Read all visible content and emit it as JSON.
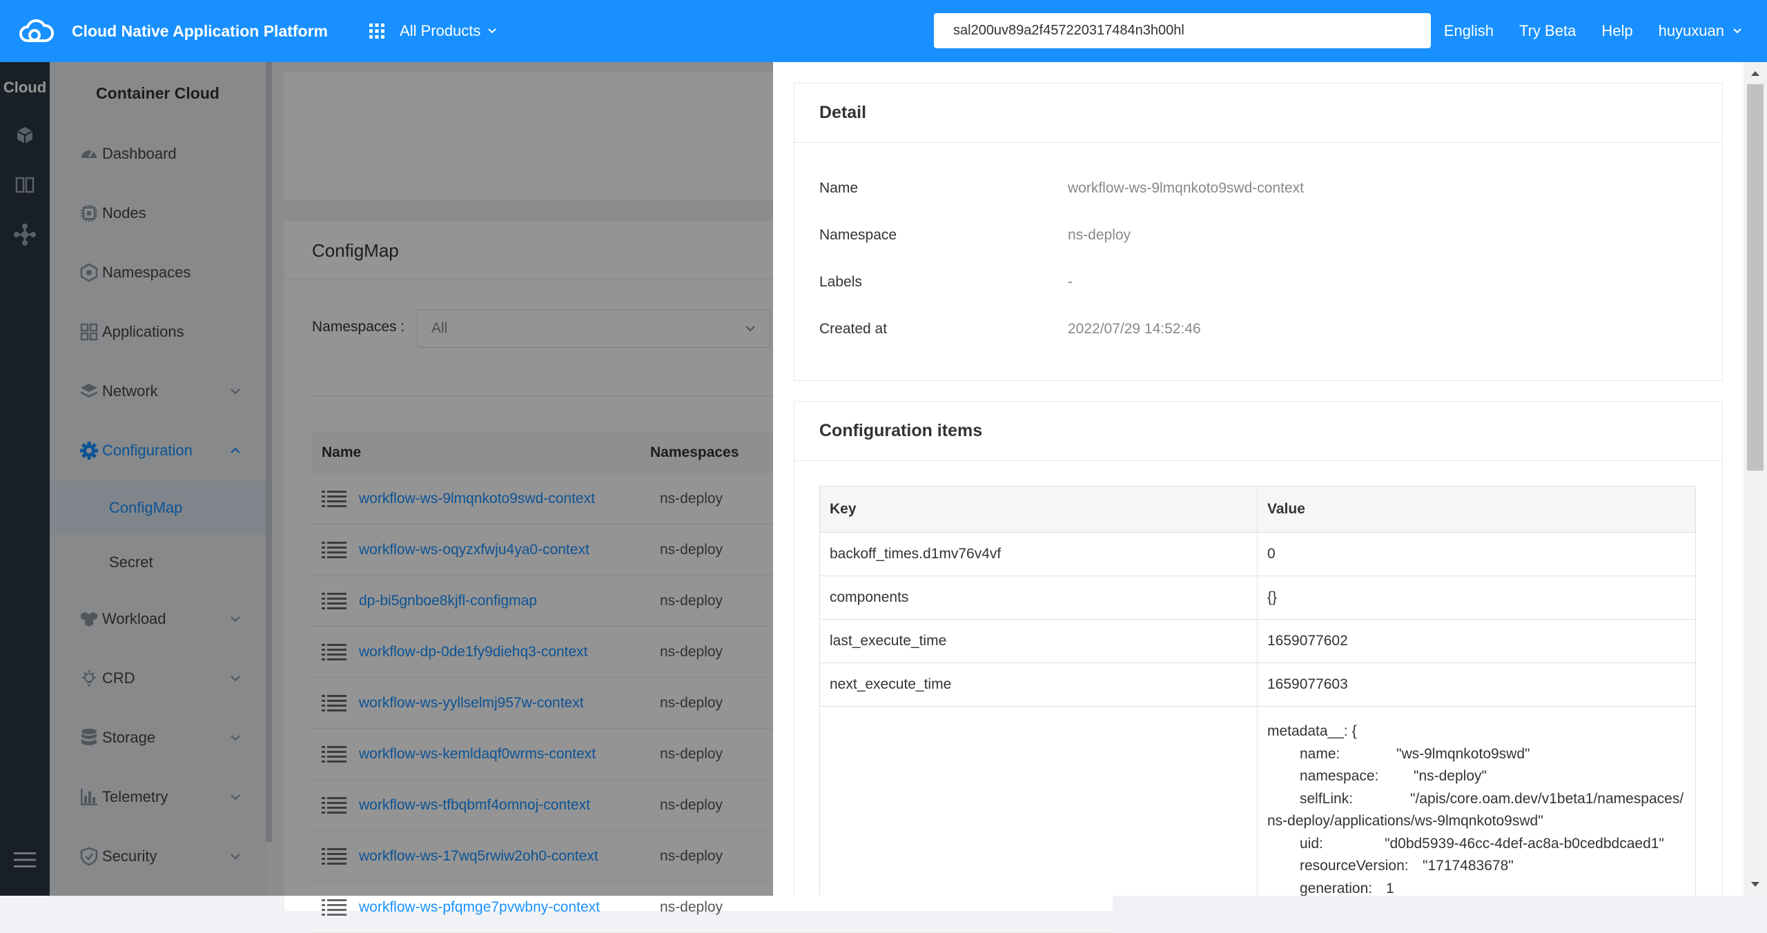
{
  "topbar": {
    "brand": "Cloud Native Application Platform",
    "products_label": "All Products",
    "search_value": "sal200uv89a2f457220317484n3h00hl",
    "nav": [
      "English",
      "Try Beta",
      "Help"
    ],
    "user": "huyuxuan"
  },
  "rail": {
    "title": "Cloud"
  },
  "sidebar": {
    "title": "Container Cloud",
    "items": [
      {
        "label": "Dashboard",
        "icon": "dashboard-icon"
      },
      {
        "label": "Nodes",
        "icon": "chip-icon"
      },
      {
        "label": "Namespaces",
        "icon": "hexagon-icon"
      },
      {
        "label": "Applications",
        "icon": "apps-grid-icon"
      },
      {
        "label": "Network",
        "icon": "layers-icon"
      },
      {
        "label": "Configuration",
        "icon": "gear-icon"
      },
      {
        "label": "Workload",
        "icon": "cubes-icon"
      },
      {
        "label": "CRD",
        "icon": "bulb-icon"
      },
      {
        "label": "Storage",
        "icon": "database-icon"
      },
      {
        "label": "Telemetry",
        "icon": "bar-chart-icon"
      },
      {
        "label": "Security",
        "icon": "shield-icon"
      }
    ],
    "sub_items": [
      "ConfigMap",
      "Secret"
    ]
  },
  "main": {
    "card_title": "ConfigMap",
    "ns_label": "Namespaces :",
    "ns_value": "All",
    "columns": [
      "Name",
      "Namespaces"
    ],
    "rows": [
      {
        "name": "workflow-ws-9lmqnkoto9swd-context",
        "ns": "ns-deploy"
      },
      {
        "name": "workflow-ws-oqyzxfwju4ya0-context",
        "ns": "ns-deploy"
      },
      {
        "name": "dp-bi5gnboe8kjfl-configmap",
        "ns": "ns-deploy"
      },
      {
        "name": "workflow-dp-0de1fy9diehq3-context",
        "ns": "ns-deploy"
      },
      {
        "name": "workflow-ws-yyllselmj957w-context",
        "ns": "ns-deploy"
      },
      {
        "name": "workflow-ws-kemldaqf0wrms-context",
        "ns": "ns-deploy"
      },
      {
        "name": "workflow-ws-tfbqbmf4omnoj-context",
        "ns": "ns-deploy"
      },
      {
        "name": "workflow-ws-17wq5rwiw2oh0-context",
        "ns": "ns-deploy"
      },
      {
        "name": "workflow-ws-pfqmge7pvwbny-context",
        "ns": "ns-deploy"
      }
    ]
  },
  "detail": {
    "title": "Detail",
    "fields": [
      {
        "key": "Name",
        "value": "workflow-ws-9lmqnkoto9swd-context"
      },
      {
        "key": "Namespace",
        "value": "ns-deploy"
      },
      {
        "key": "Labels",
        "value": "-"
      },
      {
        "key": "Created at",
        "value": "2022/07/29 14:52:46"
      }
    ]
  },
  "config": {
    "title": "Configuration items",
    "columns": [
      "Key",
      "Value"
    ],
    "rows": [
      {
        "key": "backoff_times.d1mv76v4vf",
        "value": "0"
      },
      {
        "key": "components",
        "value": "{}"
      },
      {
        "key": "last_execute_time",
        "value": "1659077602"
      },
      {
        "key": "next_execute_time",
        "value": "1659077603"
      }
    ],
    "metadata": {
      "open": "metadata__: {",
      "lines": [
        {
          "k": "name:",
          "v": "\"ws-9lmqnkoto9swd\""
        },
        {
          "k": "namespace:",
          "v": "\"ns-deploy\""
        },
        {
          "k": "selfLink:",
          "v": "\"/apis/core.oam.dev/v1beta1/namespaces/ns-deploy/applications/ws-9lmqnkoto9swd\""
        },
        {
          "k": "uid:",
          "v": "\"d0bd5939-46cc-4def-ac8a-b0cedbdcaed1\""
        },
        {
          "k": "resourceVersion:",
          "v": "\"1717483678\""
        },
        {
          "k": "generation:",
          "v": "1"
        }
      ]
    }
  },
  "colors": {
    "primary": "#1890ff",
    "rail": "#2b3642",
    "sidebar": "#e9ecf0"
  }
}
